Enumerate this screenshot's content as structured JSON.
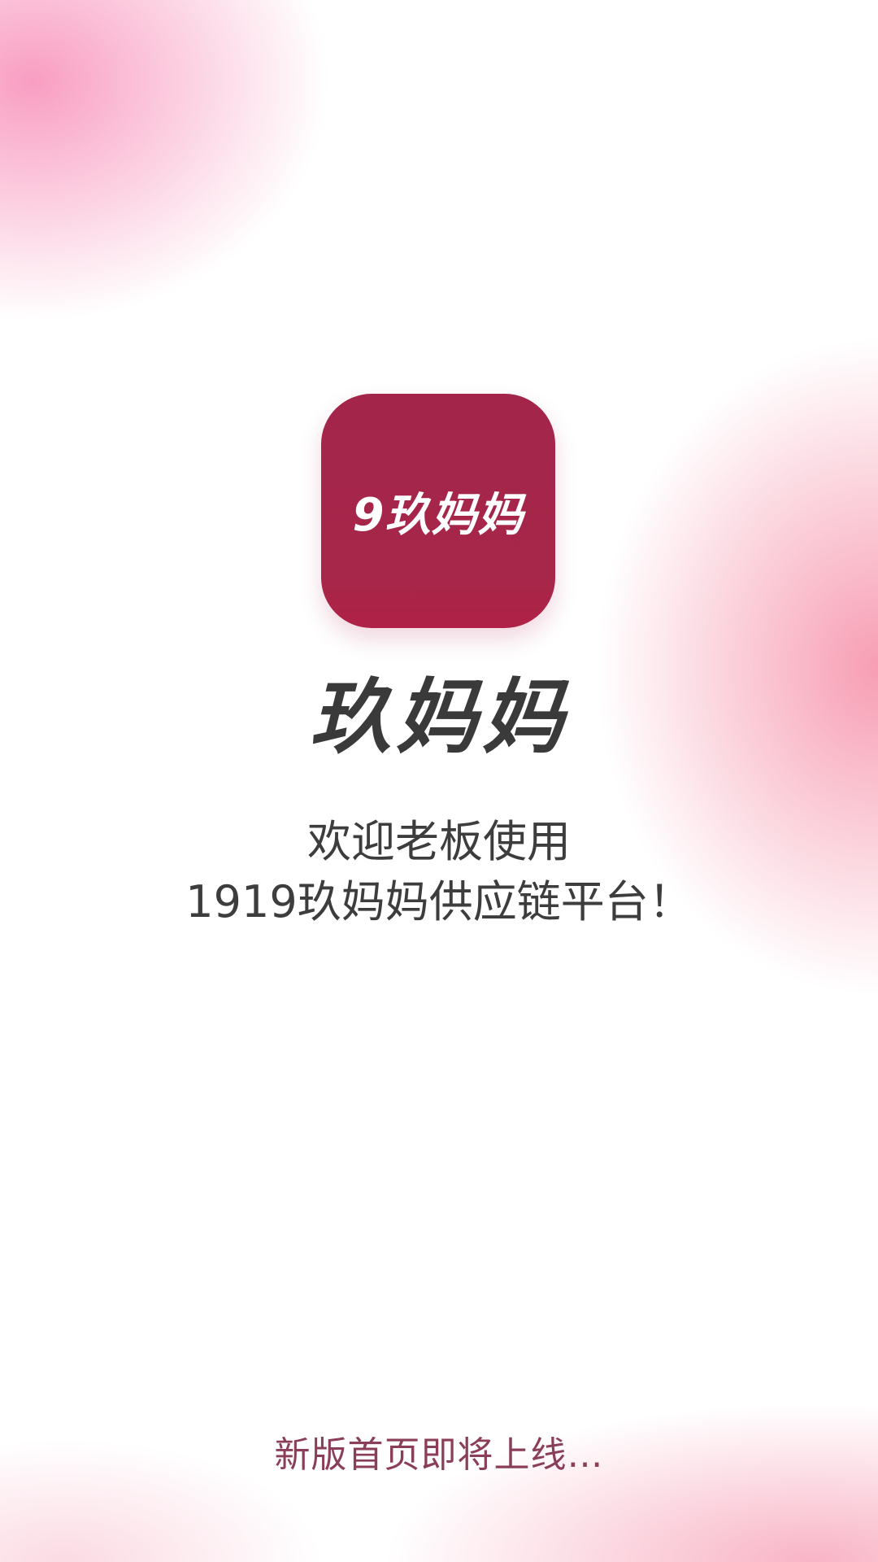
{
  "app": {
    "icon_label": "9玖妈妈",
    "brand_name": "玖妈妈"
  },
  "welcome": {
    "line1": "欢迎老板使用",
    "line2": "1919玖妈妈供应链平台！"
  },
  "footer": {
    "note": "新版首页即将上线…"
  },
  "colors": {
    "icon_background": "#a3254a",
    "brand_text": "#3a3a3a",
    "footer_text": "#8a3e58",
    "background_accent": "#f47896"
  }
}
